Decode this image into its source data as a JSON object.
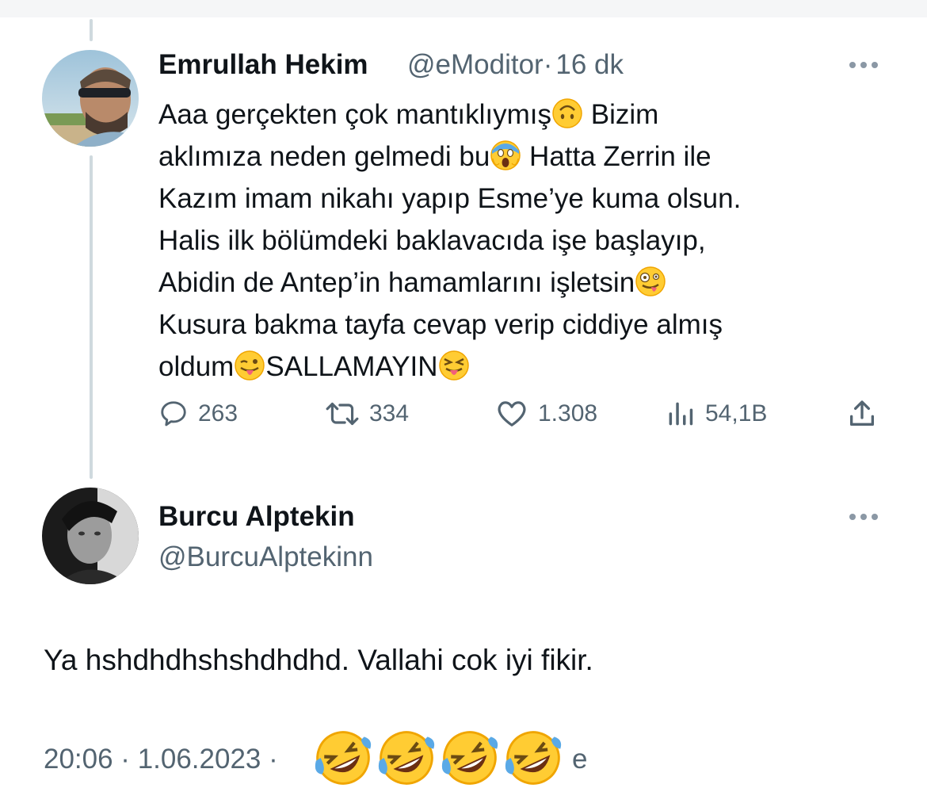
{
  "tweet": {
    "author_name": "Emrullah Hekim",
    "author_handle": "@eModitor",
    "separator": "·",
    "time_ago": "16 dk",
    "lines": [
      {
        "text": "Aaa gerçekten çok mantıklıymış",
        "emoji": "upside-down-face",
        "after": "Bizim"
      },
      {
        "text": "aklımıza neden gelmedi bu",
        "emoji": "screaming-face",
        "after": "Hatta Zerrin ile"
      },
      {
        "text": "Kazım imam nikahı yapıp Esme’ye kuma olsun."
      },
      {
        "text": "Halis ilk bölümdeki baklavacıda işe başlayıp,"
      },
      {
        "text": "Abidin de Antep’in hamamlarını işletsin",
        "emoji": "zany-face"
      },
      {
        "text": "Kusura bakma tayfa cevap verip ciddiye almış"
      },
      {
        "text": "oldum",
        "emoji": "winking-tongue-face",
        "after": "SALLAMAYIN",
        "emoji2": "squinting-tongue-face"
      }
    ],
    "stats": {
      "replies": "263",
      "retweets": "334",
      "likes": "1.308",
      "views": "54,1B"
    }
  },
  "reply": {
    "author_name": "Burcu Alptekin",
    "author_handle": "@BurcuAlptekinn",
    "text": "Ya hshdhdhshshdhdhd. Vallahi cok iyi fikir.",
    "timestamp": "20:06 · 1.06.2023 ·",
    "meta_tail": "e",
    "emojis": [
      "rolling-on-floor-laughing",
      "rolling-on-floor-laughing",
      "rolling-on-floor-laughing",
      "rolling-on-floor-laughing"
    ]
  },
  "icons": {
    "more": "more-horizontal-icon",
    "reply": "reply-bubble-icon",
    "retweet": "retweet-icon",
    "like": "heart-icon",
    "views": "views-bar-chart-icon",
    "share": "share-upload-icon"
  },
  "colors": {
    "text_primary": "#0f1419",
    "text_secondary": "#536471",
    "thread_line": "#cfd9de",
    "emoji_yellow": "#ffcc33"
  }
}
